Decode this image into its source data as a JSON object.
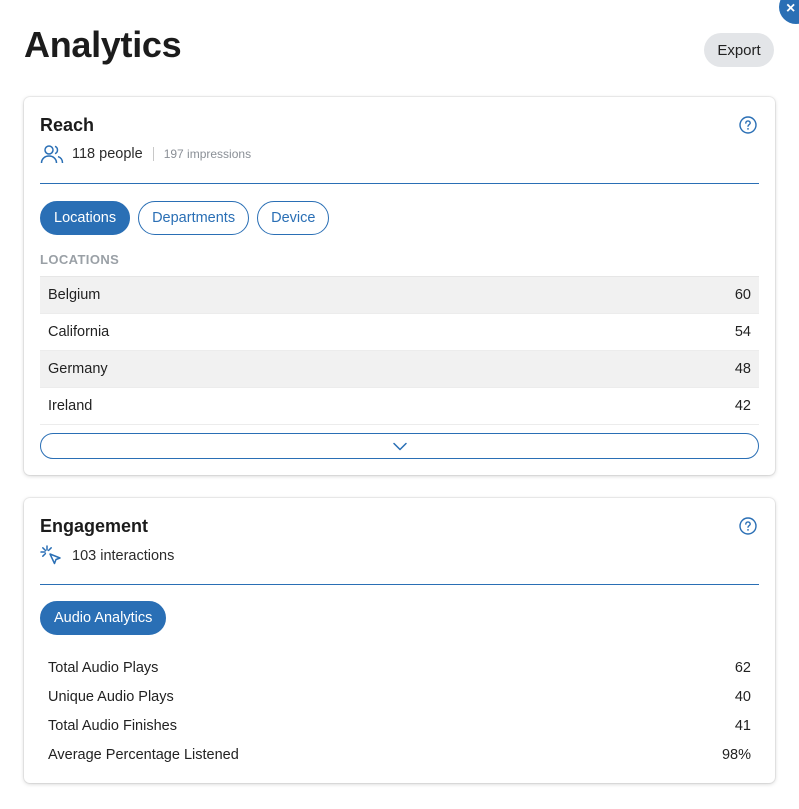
{
  "header": {
    "title": "Analytics",
    "export_label": "Export",
    "close_icon": "close-icon"
  },
  "reach": {
    "title": "Reach",
    "help_icon": "question-circle-icon",
    "people": "118 people",
    "impressions": "197 impressions",
    "tabs": [
      {
        "label": "Locations",
        "active": true
      },
      {
        "label": "Departments",
        "active": false
      },
      {
        "label": "Device",
        "active": false
      }
    ],
    "section_label": "LOCATIONS",
    "rows": [
      {
        "name": "Belgium",
        "value": "60"
      },
      {
        "name": "California",
        "value": "54"
      },
      {
        "name": "Germany",
        "value": "48"
      },
      {
        "name": "Ireland",
        "value": "42"
      }
    ],
    "expand_icon": "chevron-down-icon"
  },
  "engagement": {
    "title": "Engagement",
    "help_icon": "question-circle-icon",
    "interactions": "103 interactions",
    "tab_label": "Audio Analytics",
    "metrics": [
      {
        "name": "Total Audio Plays",
        "value": "62"
      },
      {
        "name": "Unique Audio Plays",
        "value": "40"
      },
      {
        "name": "Total Audio Finishes",
        "value": "41"
      },
      {
        "name": "Average Percentage Listened",
        "value": "98%"
      }
    ]
  },
  "colors": {
    "accent": "#2a6fb5",
    "stripe": "#f1f1f1",
    "muted": "#9aa0a6"
  }
}
